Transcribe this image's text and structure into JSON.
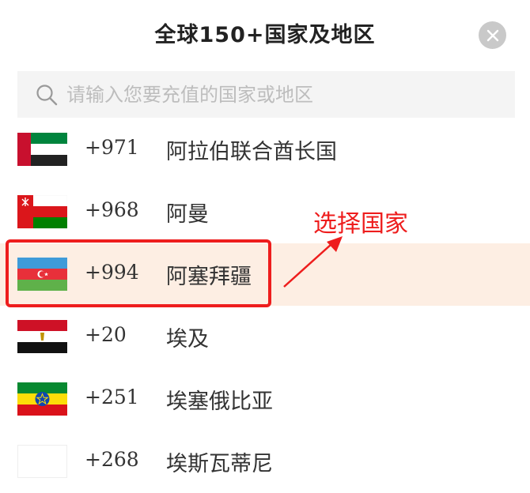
{
  "dialog": {
    "title": "全球150+国家及地区",
    "search_placeholder": "请输入您要充值的国家或地区"
  },
  "countries": [
    {
      "code": "+971",
      "name": "阿拉伯联合酋长国",
      "flag": "uae-flag",
      "selected": false
    },
    {
      "code": "+968",
      "name": "阿曼",
      "flag": "oman-flag",
      "selected": false
    },
    {
      "code": "+994",
      "name": "阿塞拜疆",
      "flag": "azerbaijan-flag",
      "selected": true
    },
    {
      "code": "+20",
      "name": "埃及",
      "flag": "egypt-flag",
      "selected": false
    },
    {
      "code": "+251",
      "name": "埃塞俄比亚",
      "flag": "ethiopia-flag",
      "selected": false
    },
    {
      "code": "+268",
      "name": "埃斯瓦蒂尼",
      "flag": "eswatini-flag",
      "selected": false
    }
  ],
  "annotation": {
    "text": "选择国家"
  },
  "colors": {
    "selected_row_bg": "#fdeee3",
    "annotation_red": "#ee1d1d",
    "close_button_bg": "#c9c9c9",
    "search_bg": "#f4f4f4"
  }
}
